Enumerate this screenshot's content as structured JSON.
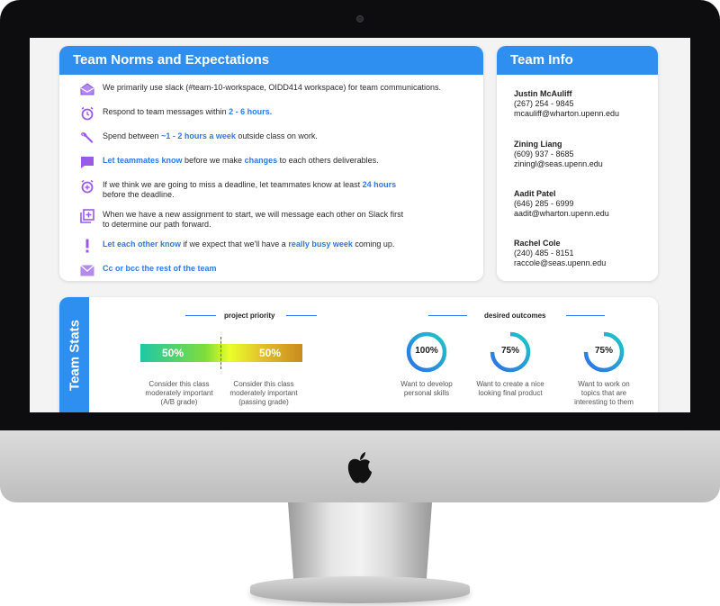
{
  "norms": {
    "title": "Team Norms and Expectations",
    "items": [
      {
        "icon": "envelope-open-icon",
        "pre": "We primarily use slack (#team-10-workspace, OIDD414 workspace) for team communications.",
        "hl": "",
        "post": "",
        "line2": ""
      },
      {
        "icon": "alarm-clock-icon",
        "pre": "Respond to team messages within ",
        "hl": "2 - 6 hours.",
        "post": "",
        "line2": ""
      },
      {
        "icon": "wrench-icon",
        "pre": "Spend between ",
        "hl": "~1 - 2 hours a week",
        "post": " outside class on work.",
        "line2": ""
      },
      {
        "icon": "chat-bubble-icon",
        "pre": "",
        "hl": "Let teammates know",
        "post": " before we make ",
        "hl2": "changes",
        "post2": " to each others deliverables.",
        "line2": ""
      },
      {
        "icon": "alarm-add-icon",
        "pre": "If we think we are going to miss a deadline, let teammates know at least ",
        "hl": "24 hours",
        "post": "",
        "line2": "before the deadline."
      },
      {
        "icon": "add-box-icon",
        "pre": "When we have a new assignment to start, we will message each other on Slack first",
        "hl": "",
        "post": "",
        "line2": "to determine our path forward."
      },
      {
        "icon": "exclamation-icon",
        "pre": "",
        "hl": "Let each other know",
        "post": " if we expect that we'll have a ",
        "hl2": "really busy week",
        "post2": " coming up.",
        "line2": ""
      },
      {
        "icon": "mail-icon",
        "pre": "",
        "hl": "Cc or bcc the rest of the team",
        "post": "",
        "line2": ""
      }
    ]
  },
  "info": {
    "title": "Team Info",
    "contacts": [
      {
        "name": "Justin McAuliff",
        "phone": "(267) 254 - 9845",
        "email": "mcauliff@wharton.upenn.edu"
      },
      {
        "name": "Zining Liang",
        "phone": "(609) 937 - 8685",
        "email": "ziningl@seas.upenn.edu"
      },
      {
        "name": "Aadit Patel",
        "phone": "(646) 285 - 6999",
        "email": "aadit@wharton.upenn.edu"
      },
      {
        "name": "Rachel Cole",
        "phone": "(240) 485 - 8151",
        "email": "raccole@seas.upenn.edu"
      }
    ]
  },
  "stats": {
    "tab_label": "Team Stats",
    "priority": {
      "title": "project priority",
      "left_pct": "50%",
      "right_pct": "50%",
      "left_caption": [
        "Consider this class",
        "moderately important",
        "(A/B grade)"
      ],
      "right_caption": [
        "Consider this class",
        "moderately important",
        "(passing grade)"
      ]
    },
    "outcomes": {
      "title": "desired outcomes",
      "rings": [
        {
          "label": "100%",
          "value": 100,
          "caption": [
            "Want to develop",
            "personal skills"
          ]
        },
        {
          "label": "75%",
          "value": 75,
          "caption": [
            "Want to create a nice",
            "looking final product"
          ]
        },
        {
          "label": "75%",
          "value": 75,
          "caption": [
            "Want to work on",
            "topics that are",
            "interesting to them"
          ]
        }
      ]
    }
  },
  "colors": {
    "accent": "#2f8ff0",
    "highlight": "#2f78e8",
    "icon": "#9b59e8"
  }
}
